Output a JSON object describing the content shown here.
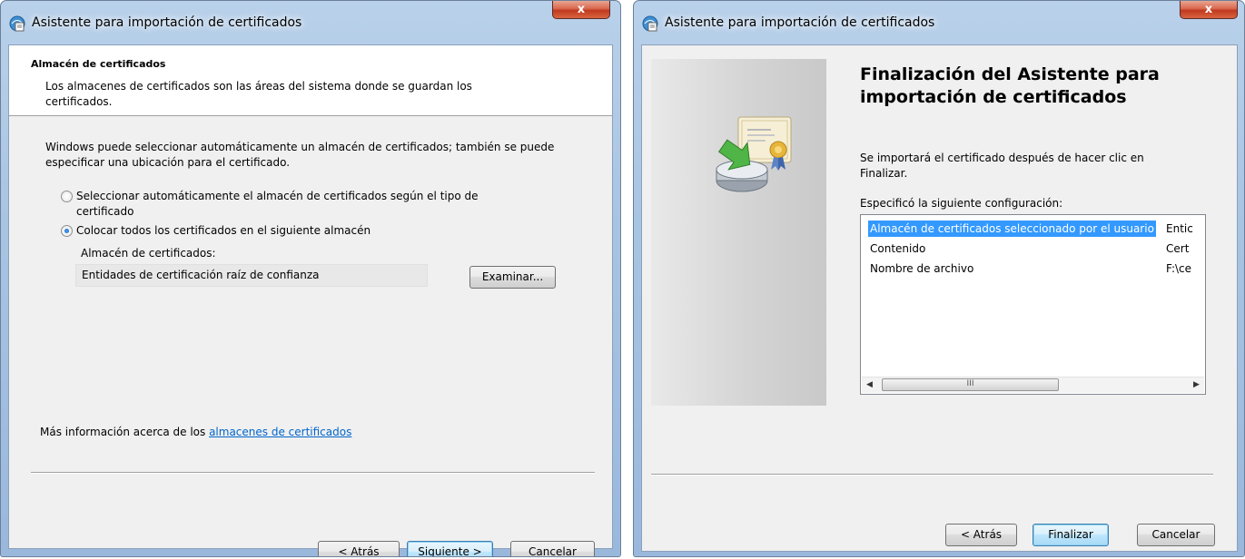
{
  "left_dialog": {
    "title": "Asistente para importación de certificados",
    "close_label": "x",
    "header_title": "Almacén de certificados",
    "header_desc": "Los almacenes de certificados son las áreas del sistema donde se guardan los certificados.",
    "intro": "Windows puede seleccionar automáticamente un almacén de certificados; también se puede especificar una ubicación para el certificado.",
    "radio_auto": "Seleccionar automáticamente el almacén de certificados según el tipo de certificado",
    "radio_manual": "Colocar todos los certificados en el siguiente almacén",
    "store_label": "Almacén de certificados:",
    "store_value": "Entidades de certificación raíz de confianza",
    "browse_label": "Examinar...",
    "more_info_prefix": "Más información acerca de los ",
    "more_info_link": "almacenes de certificados",
    "back_label": "< Atrás",
    "next_label": "Siguiente >",
    "cancel_label": "Cancelar"
  },
  "right_dialog": {
    "title": "Asistente para importación de certificados",
    "close_label": "x",
    "heading": "Finalización del Asistente para importación de certificados",
    "text": "Se importará el certificado después de hacer clic en Finalizar.",
    "spec_label": "Especificó la siguiente configuración:",
    "rows": [
      {
        "key": "Almacén de certificados seleccionado por el usuario",
        "value": "Entic"
      },
      {
        "key": "Contenido",
        "value": "Cert"
      },
      {
        "key": "Nombre de archivo",
        "value": "F:\\ce"
      }
    ],
    "scroll_thumb": "III",
    "back_label": "< Atrás",
    "finish_label": "Finalizar",
    "cancel_label": "Cancelar"
  },
  "colors": {
    "link": "#0066cc",
    "selection": "#3399ff",
    "close_button": "#c0391f"
  },
  "icons": [
    "certificate-app-icon",
    "close-icon",
    "radio-icon",
    "certificate-import-icon",
    "scroll-left-icon",
    "scroll-right-icon"
  ]
}
